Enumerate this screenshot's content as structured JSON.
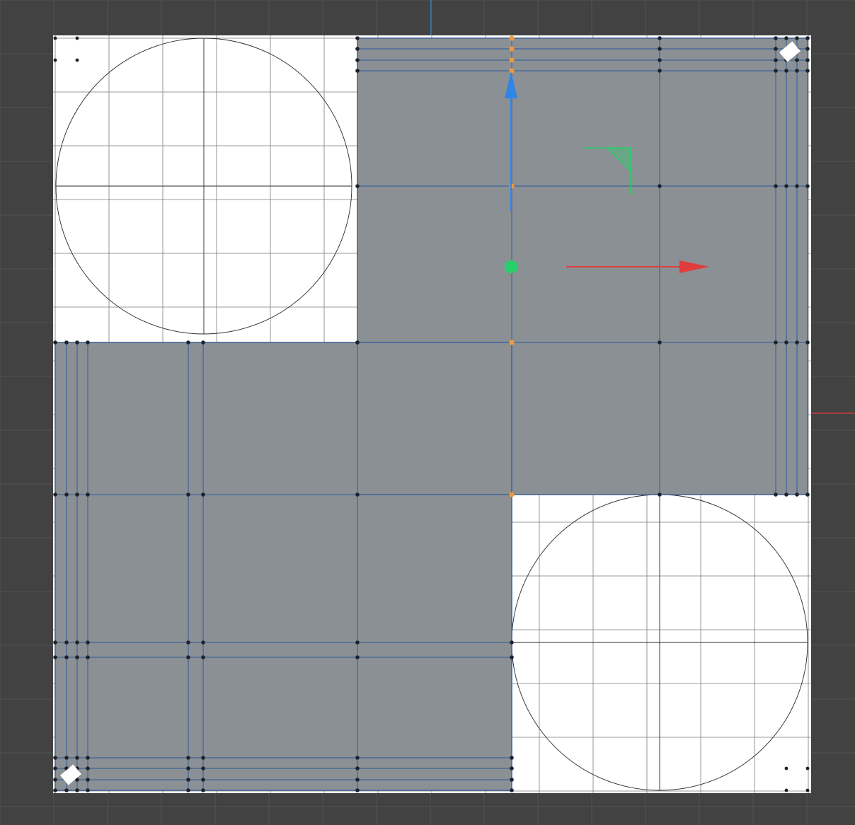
{
  "viewport": {
    "background_color": "#424242",
    "grid_color": "#525252",
    "canvas_color": "#ffffff",
    "canvas_grid_color": "#7a7a7a",
    "mesh_fill_color": "#8b9094",
    "mesh_edge_color": "#4a6a9a",
    "vertex_color": "#1e232b",
    "selected_vertex_color": "#f09a3a",
    "circle_color": "#2a2a2a"
  },
  "gizmo": {
    "move_y_color": "#2f86e6",
    "move_x_color": "#e03c3c",
    "center_color": "#27d06a",
    "plane_color": "#27d06a",
    "origin_y_axis_color": "#2f86e6",
    "origin_x_axis_color": "#e03c3c"
  },
  "icons": {
    "gizmo_y_arrow": "arrow-up-icon",
    "gizmo_x_arrow": "arrow-right-icon",
    "gizmo_center": "hexagon-icon",
    "gizmo_plane": "plane-handle-icon"
  }
}
